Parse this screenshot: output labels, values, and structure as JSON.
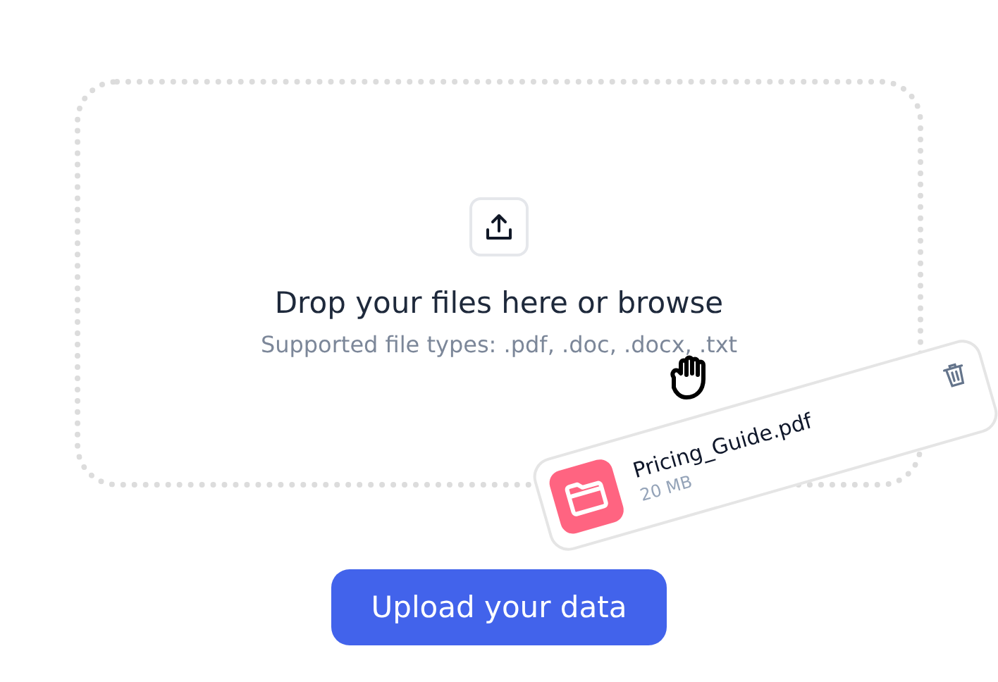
{
  "dropzone": {
    "title": "Drop your files here or browse",
    "subtitle": "Supported file types: .pdf, .doc, .docx, .txt"
  },
  "dragged_file": {
    "name": "Pricing_Guide.pdf",
    "size": "20 MB"
  },
  "upload_button": {
    "label": "Upload your data"
  }
}
